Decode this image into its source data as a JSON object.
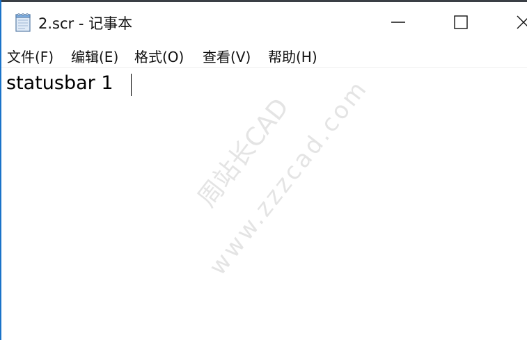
{
  "window": {
    "title": "2.scr - 记事本",
    "accent_color": "#1a73c9"
  },
  "menu": {
    "items": [
      {
        "label": "文件(F)"
      },
      {
        "label": "编辑(E)"
      },
      {
        "label": "格式(O)"
      },
      {
        "label": "查看(V)"
      },
      {
        "label": "帮助(H)"
      }
    ]
  },
  "editor": {
    "content": "statusbar 1"
  },
  "watermark": {
    "line1": "周站长CAD",
    "line2": "www.zzzcad.com"
  },
  "icons": {
    "app": "notepad-icon",
    "minimize": "minimize-icon",
    "maximize": "maximize-icon",
    "close": "close-icon"
  }
}
